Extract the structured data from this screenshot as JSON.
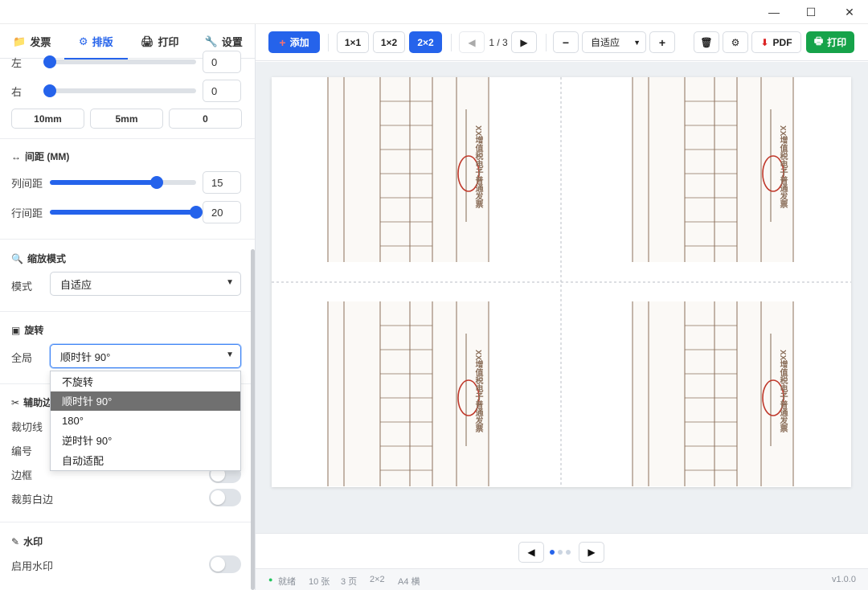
{
  "window": {
    "minimize_icon": "—",
    "maximize_icon": "☐",
    "close_icon": "✕"
  },
  "tabs": [
    {
      "icon": "📁",
      "label": "发票"
    },
    {
      "icon": "⚙",
      "label": "排版"
    },
    {
      "icon": "🖨",
      "label": "打印"
    },
    {
      "icon": "🔧",
      "label": "设置"
    }
  ],
  "margins": {
    "left_label": "左",
    "left_value": "0",
    "left_fraction": 0,
    "right_label": "右",
    "right_value": "0",
    "right_fraction": 0,
    "presets": [
      "10mm",
      "5mm",
      "0"
    ]
  },
  "spacing": {
    "title_icon": "↔",
    "title": "间距 (MM)",
    "col_label": "列间距",
    "col_value": "15",
    "col_fraction": 0.73,
    "row_label": "行间距",
    "row_value": "20",
    "row_fraction": 1.0
  },
  "scale": {
    "title_icon": "🔍",
    "title": "缩放模式",
    "mode_label": "模式",
    "mode_value": "自适应"
  },
  "rotate": {
    "title_icon": "▣",
    "title": "旋转",
    "global_label": "全局",
    "value": "顺时针 90°",
    "options": [
      "不旋转",
      "顺时针 90°",
      "180°",
      "逆时针 90°",
      "自动适配"
    ]
  },
  "aux": {
    "title_icon": "✂",
    "title": "辅助边",
    "cut_line": "裁切线",
    "numbering": "编号",
    "border": "边框",
    "trim_white": "裁剪白边"
  },
  "watermark": {
    "title_icon": "✎",
    "title": "水印",
    "enable_label": "启用水印"
  },
  "toolbar": {
    "add_icon": "+",
    "add_label": "添加",
    "layouts": [
      "1×1",
      "1×2",
      "2×2"
    ],
    "prev_icon": "◀",
    "page_indicator": "1 / 3",
    "next_icon": "▶",
    "zoom_out": "−",
    "zoom_value": "自适应",
    "zoom_in": "+",
    "trash_icon": "🗑",
    "gear_icon": "⚙",
    "pdf_icon": "⬇",
    "pdf_label": "PDF",
    "print_icon": "🖶",
    "print_label": "打印"
  },
  "invoice": {
    "title": "XX增值税电子普通发票"
  },
  "pager": {
    "prev_icon": "◀",
    "next_icon": "▶"
  },
  "status": {
    "ready_dot": "●",
    "ready": "就绪",
    "count": "10 张",
    "pages": "3 页",
    "layout": "2×2",
    "paper": "A4 横",
    "version": "v1.0.0"
  },
  "colors": {
    "accent": "#2563eb",
    "print": "#16a34a",
    "stamp": "#c0392b",
    "invoice_line": "#8b6f5a"
  }
}
